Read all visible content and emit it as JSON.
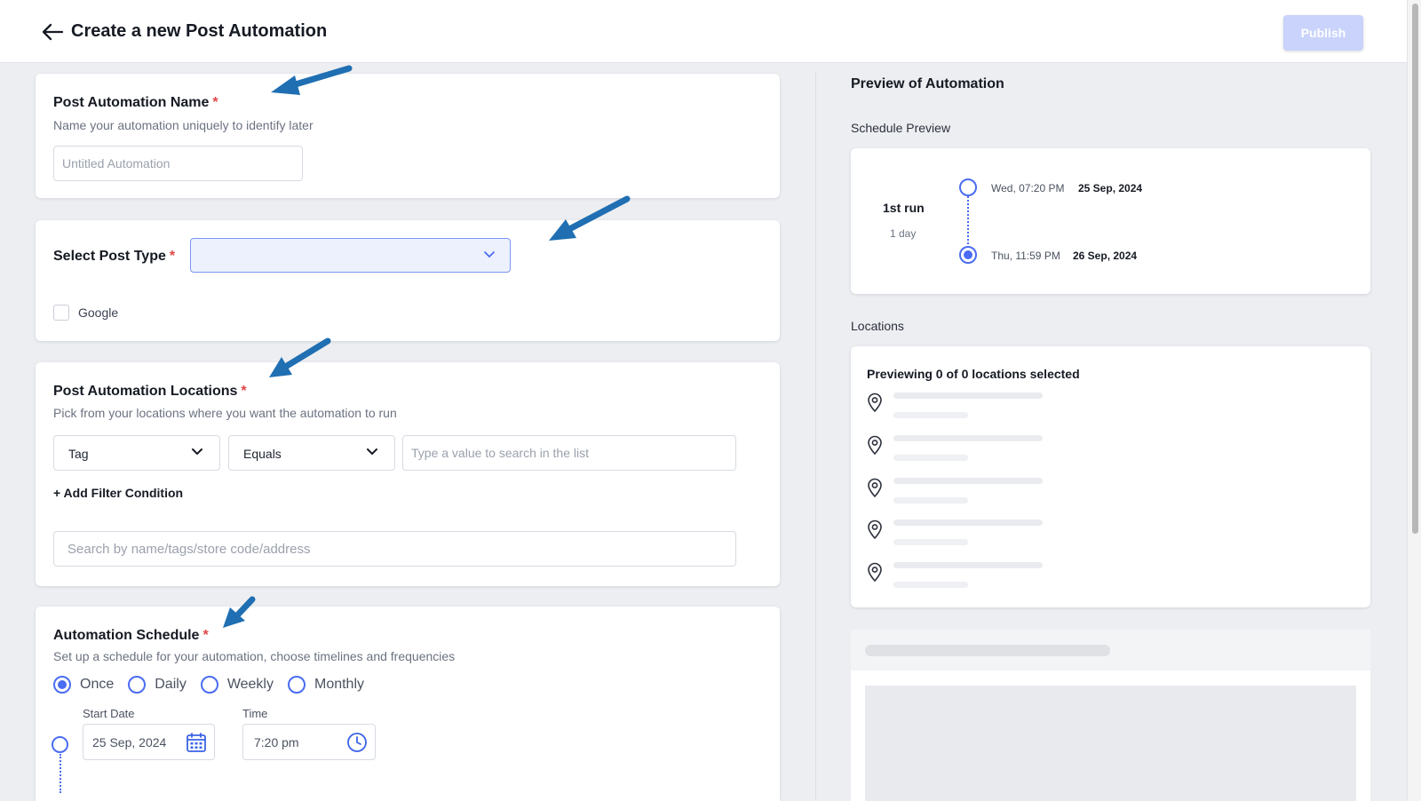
{
  "header": {
    "back_icon": "arrow-left-icon",
    "title": "Create a new Post Automation",
    "publish_label": "Publish"
  },
  "name_card": {
    "title": "Post Automation Name",
    "required_mark": "*",
    "subtitle": "Name your automation uniquely to identify later",
    "input_placeholder": "Untitled Automation",
    "input_value": ""
  },
  "post_type_card": {
    "title": "Select Post Type",
    "required_mark": "*",
    "selected_value": "",
    "chevron_icon": "chevron-down-icon",
    "options": [
      {
        "label": "Google",
        "checked": false
      }
    ]
  },
  "locations_card": {
    "title": "Post Automation Locations",
    "required_mark": "*",
    "subtitle": "Pick from your locations where you want the automation to run",
    "filter_field": "Tag",
    "filter_operator": "Equals",
    "filter_value_placeholder": "Type a value to search in the list",
    "add_filter_label": "+ Add Filter Condition",
    "search_placeholder": "Search by name/tags/store code/address"
  },
  "schedule_card": {
    "title": "Automation Schedule",
    "required_mark": "*",
    "subtitle": "Set up a schedule for your automation, choose timelines and frequencies",
    "frequencies": [
      {
        "label": "Once",
        "selected": true
      },
      {
        "label": "Daily",
        "selected": false
      },
      {
        "label": "Weekly",
        "selected": false
      },
      {
        "label": "Monthly",
        "selected": false
      }
    ],
    "start_date_label": "Start Date",
    "start_date_value": "25 Sep, 2024",
    "calendar_icon": "calendar-icon",
    "time_label": "Time",
    "time_value": "7:20 pm",
    "clock_icon": "clock-icon"
  },
  "preview": {
    "title": "Preview of Automation",
    "schedule_label": "Schedule Preview",
    "run_label": "1st run",
    "run_duration": "1 day",
    "start": {
      "time": "Wed, 07:20 PM",
      "date": "25 Sep, 2024"
    },
    "end": {
      "time": "Thu, 11:59 PM",
      "date": "26 Sep, 2024"
    },
    "locations_label": "Locations",
    "locations_heading": "Previewing 0 of 0 locations selected",
    "location_placeholder_count": 5,
    "pin_icon": "location-pin-icon"
  },
  "colors": {
    "accent": "#4a6cf0",
    "publish_disabled": "#c9d3fb",
    "required": "#e04646",
    "annotation_arrow": "#1f6fb2",
    "background": "#eceef1"
  }
}
